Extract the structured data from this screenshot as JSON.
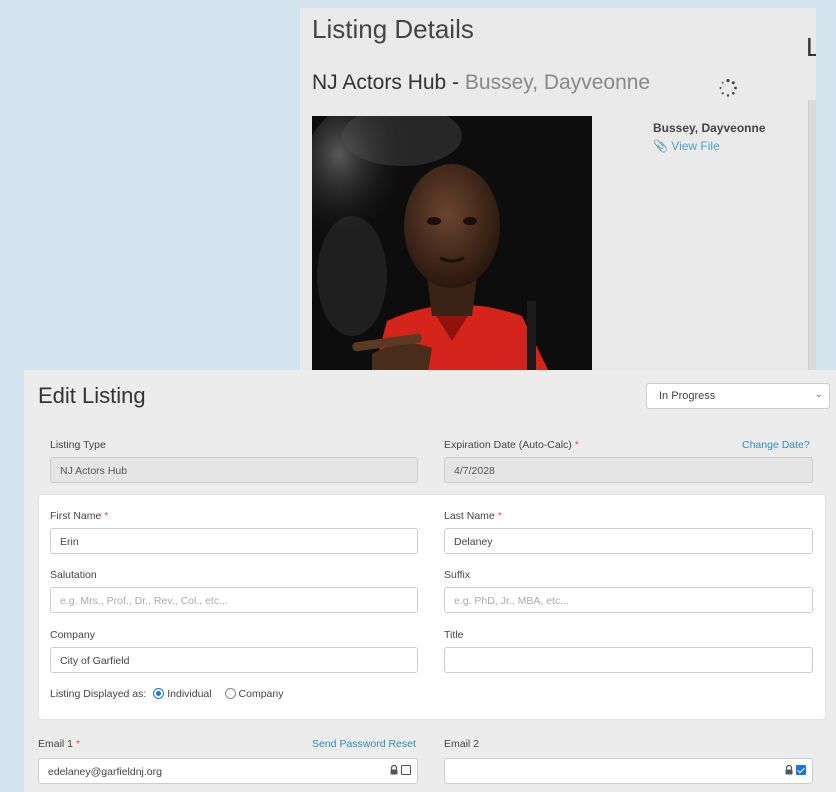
{
  "listing_details": {
    "title": "Listing Details",
    "edge_letter": "L",
    "subtitle_hub": "NJ Actors Hub - ",
    "subtitle_name": "Bussey, Dayveonne",
    "file_owner": "Bussey, Dayveonne",
    "view_file": "View File"
  },
  "edit_listing": {
    "title": "Edit Listing",
    "status": "In Progress",
    "listing_type_label": "Listing Type",
    "listing_type_value": "NJ Actors Hub",
    "expiration_label": "Expiration Date (Auto-Calc)",
    "expiration_value": "4/7/2028",
    "change_date": "Change Date?",
    "first_name_label": "First Name",
    "first_name_value": "Erin",
    "last_name_label": "Last Name",
    "last_name_value": "Delaney",
    "salutation_label": "Salutation",
    "salutation_placeholder": "e.g. Mrs., Prof., Dr., Rev., Col., etc...",
    "suffix_label": "Suffix",
    "suffix_placeholder": "e.g. PhD, Jr., MBA, etc...",
    "company_label": "Company",
    "company_value": "City of Garfield",
    "title_label": "Title",
    "title_value": "",
    "displayed_as_label": "Listing Displayed as:",
    "option_individual": "Individual",
    "option_company": "Company",
    "displayed_as_selected": "Individual",
    "email1_label": "Email 1",
    "send_password_reset": "Send Password Reset",
    "email1_value": "edelaney@garfieldnj.org",
    "email1_checked": false,
    "email2_label": "Email 2",
    "email2_value": "",
    "email2_checked": true,
    "required_mark": "*"
  }
}
